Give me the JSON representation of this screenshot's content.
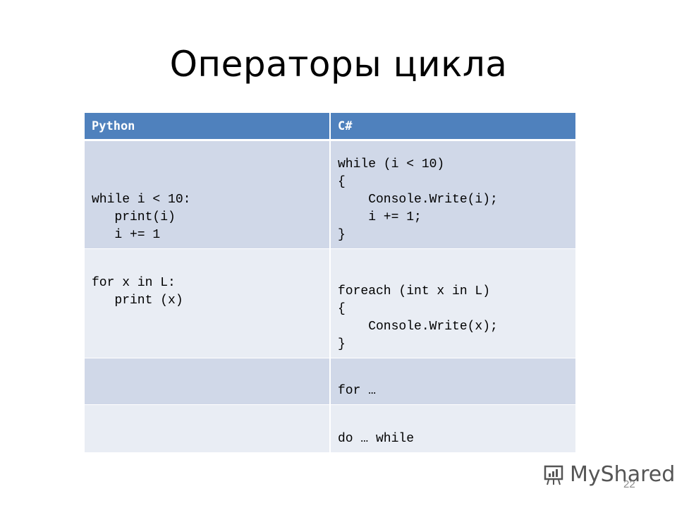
{
  "title": "Операторы цикла",
  "table": {
    "headers": [
      "Python",
      "C#"
    ],
    "rows": [
      [
        "while i < 10:\n   print(i)\n   i += 1",
        "while (i < 10)\n{\n    Console.Write(i);\n    i += 1;\n}"
      ],
      [
        "for x in L:\n   print (x)",
        "foreach (int x in L)\n{\n    Console.Write(x);\n}"
      ],
      [
        "",
        "for …"
      ],
      [
        "",
        "do … while"
      ]
    ]
  },
  "watermark": "MyShared",
  "page_number": "22"
}
